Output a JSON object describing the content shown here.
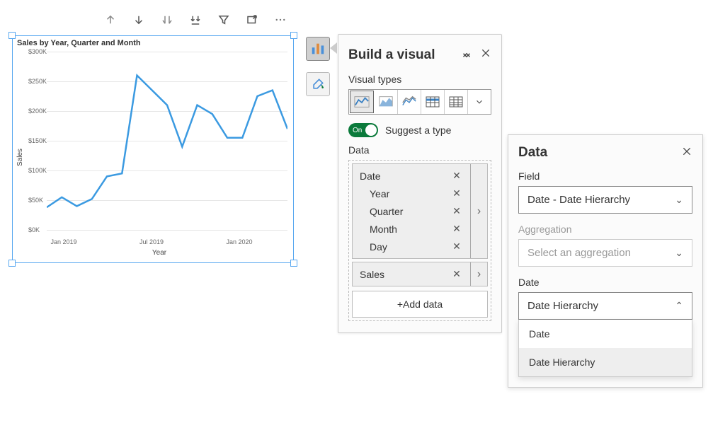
{
  "chart_data": {
    "type": "line",
    "title": "Sales by Year, Quarter and Month",
    "xlabel": "Year",
    "ylabel": "Sales",
    "y_ticks": [
      "$0K",
      "$50K",
      "$100K",
      "$150K",
      "$200K",
      "$250K",
      "$300K"
    ],
    "x_ticks": [
      "Jan 2019",
      "Jul 2019",
      "Jan 2020"
    ],
    "ylim": [
      0,
      300000
    ],
    "x": [
      "Jan 2019",
      "Feb 2019",
      "Mar 2019",
      "Apr 2019",
      "May 2019",
      "Jun 2019",
      "Jul 2019",
      "Aug 2019",
      "Sep 2019",
      "Oct 2019",
      "Nov 2019",
      "Dec 2019",
      "Jan 2020",
      "Feb 2020",
      "Mar 2020",
      "Apr 2020",
      "May 2020"
    ],
    "values": [
      38000,
      55000,
      40000,
      52000,
      90000,
      95000,
      260000,
      235000,
      210000,
      140000,
      210000,
      195000,
      155000,
      155000,
      225000,
      235000,
      170000
    ]
  },
  "build_panel": {
    "title": "Build a visual",
    "visual_types_label": "Visual types",
    "suggest_toggle_on": "On",
    "suggest_label": "Suggest a type",
    "data_label": "Data",
    "fields": {
      "date": "Date",
      "year": "Year",
      "quarter": "Quarter",
      "month": "Month",
      "day": "Day"
    },
    "sales_field": "Sales",
    "add_data": "+Add data"
  },
  "data_panel": {
    "title": "Data",
    "field_label": "Field",
    "field_value": "Date - Date Hierarchy",
    "aggregation_label": "Aggregation",
    "aggregation_placeholder": "Select an aggregation",
    "date_label": "Date",
    "date_value": "Date Hierarchy",
    "dropdown_options": [
      "Date",
      "Date Hierarchy"
    ]
  }
}
